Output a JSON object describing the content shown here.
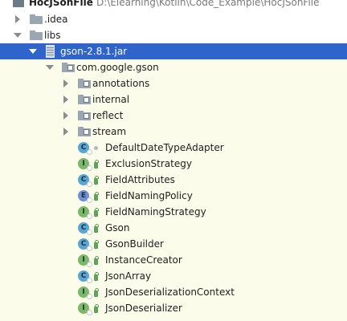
{
  "project": {
    "name": "HocJSonFile",
    "path": "D:\\Elearning\\Kotlin\\Code_Example\\HocJSonFile"
  },
  "tree": {
    "idea_folder": ".idea",
    "libs_folder": "libs",
    "jar": "gson-2.8.1.jar",
    "package": "com.google.gson",
    "subpackages": [
      "annotations",
      "internal",
      "reflect",
      "stream"
    ],
    "classes": [
      {
        "name": "DefaultDateTypeAdapter",
        "kind": "class",
        "letter": "C",
        "visibility": "package-private"
      },
      {
        "name": "ExclusionStrategy",
        "kind": "interface",
        "letter": "I",
        "visibility": "public"
      },
      {
        "name": "FieldAttributes",
        "kind": "class",
        "letter": "C",
        "visibility": "public"
      },
      {
        "name": "FieldNamingPolicy",
        "kind": "enum",
        "letter": "E",
        "visibility": "public"
      },
      {
        "name": "FieldNamingStrategy",
        "kind": "interface",
        "letter": "I",
        "visibility": "public"
      },
      {
        "name": "Gson",
        "kind": "class",
        "letter": "C",
        "visibility": "public"
      },
      {
        "name": "GsonBuilder",
        "kind": "class",
        "letter": "C",
        "visibility": "public"
      },
      {
        "name": "InstanceCreator",
        "kind": "interface",
        "letter": "I",
        "visibility": "public"
      },
      {
        "name": "JsonArray",
        "kind": "class",
        "letter": "C",
        "visibility": "public"
      },
      {
        "name": "JsonDeserializationContext",
        "kind": "interface",
        "letter": "I",
        "visibility": "public"
      },
      {
        "name": "JsonDeserializer",
        "kind": "interface",
        "letter": "I",
        "visibility": "public"
      }
    ]
  },
  "colors": {
    "selection": "#2f65ca",
    "library_tint": "#fcfcea",
    "class_icon": "#57a6d6",
    "interface_icon": "#7bb867",
    "enum_icon": "#6e91d7",
    "folder": "#9aa6b1"
  }
}
